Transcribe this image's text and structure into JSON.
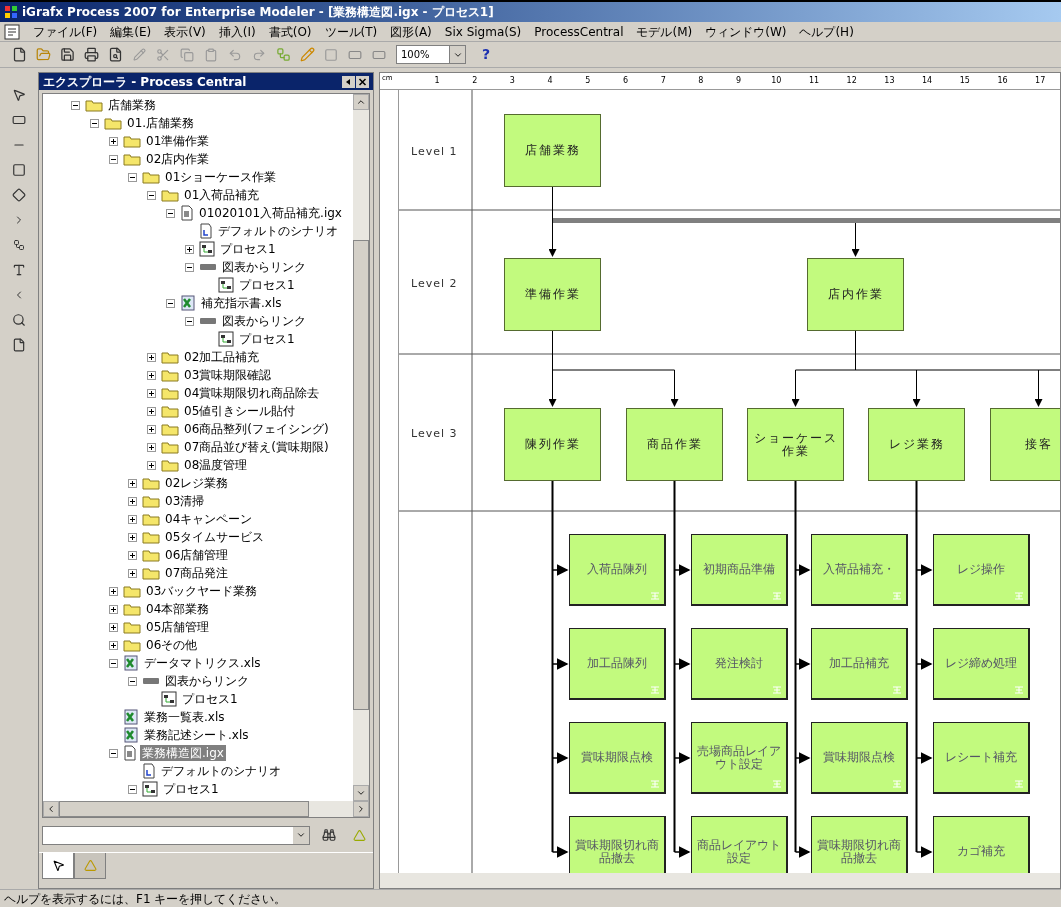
{
  "window": {
    "title": "iGrafx Process 2007 for Enterprise Modeler - [業務構造図.igx - プロセス1]"
  },
  "menu": [
    "ファイル(F)",
    "編集(E)",
    "表示(V)",
    "挿入(I)",
    "書式(O)",
    "ツール(T)",
    "図形(A)",
    "Six Sigma(S)",
    "ProcessCentral",
    "モデル(M)",
    "ウィンドウ(W)",
    "ヘルプ(H)"
  ],
  "toolbar": {
    "zoom": "100%",
    "help": "?"
  },
  "explorer": {
    "title": "エクスプローラ - Process Central",
    "tree": [
      {
        "label": "店舗業務",
        "kind": "folder",
        "expanded": true,
        "selected": false,
        "children": [
          {
            "label": "01.店舗業務",
            "kind": "folder",
            "expanded": true,
            "selected": false,
            "children": [
              {
                "label": "01準備作業",
                "kind": "folder",
                "expanded": false,
                "selected": false
              },
              {
                "label": "02店内作業",
                "kind": "folder",
                "expanded": true,
                "selected": false,
                "children": [
                  {
                    "label": "01ショーケース作業",
                    "kind": "folder",
                    "expanded": true,
                    "selected": false,
                    "children": [
                      {
                        "label": "01入荷品補充",
                        "kind": "folder",
                        "expanded": true,
                        "selected": false,
                        "children": [
                          {
                            "label": "01020101入荷品補充.igx",
                            "kind": "document",
                            "expanded": true,
                            "selected": false,
                            "children": [
                              {
                                "label": "デフォルトのシナリオ",
                                "kind": "scenario",
                                "selected": false
                              },
                              {
                                "label": "プロセス1",
                                "kind": "process",
                                "expanded": false,
                                "selected": false
                              },
                              {
                                "label": "図表からリンク",
                                "kind": "link",
                                "expanded": true,
                                "selected": false,
                                "children": [
                                  {
                                    "label": "プロセス1",
                                    "kind": "process",
                                    "selected": false
                                  }
                                ]
                              }
                            ]
                          },
                          {
                            "label": "補充指示書.xls",
                            "kind": "sheet",
                            "expanded": true,
                            "selected": false,
                            "children": [
                              {
                                "label": "図表からリンク",
                                "kind": "link",
                                "expanded": true,
                                "selected": false,
                                "children": [
                                  {
                                    "label": "プロセス1",
                                    "kind": "process",
                                    "selected": false
                                  }
                                ]
                              }
                            ]
                          }
                        ]
                      },
                      {
                        "label": "02加工品補充",
                        "kind": "folder",
                        "expanded": false,
                        "selected": false
                      },
                      {
                        "label": "03賞味期限確認",
                        "kind": "folder",
                        "expanded": false,
                        "selected": false
                      },
                      {
                        "label": "04賞味期限切れ商品除去",
                        "kind": "folder",
                        "expanded": false,
                        "selected": false
                      },
                      {
                        "label": "05値引きシール貼付",
                        "kind": "folder",
                        "expanded": false,
                        "selected": false
                      },
                      {
                        "label": "06商品整列(フェイシング)",
                        "kind": "folder",
                        "expanded": false,
                        "selected": false
                      },
                      {
                        "label": "07商品並び替え(賞味期限)",
                        "kind": "folder",
                        "expanded": false,
                        "selected": false
                      },
                      {
                        "label": "08温度管理",
                        "kind": "folder",
                        "expanded": false,
                        "selected": false
                      }
                    ]
                  },
                  {
                    "label": "02レジ業務",
                    "kind": "folder",
                    "expanded": false,
                    "selected": false
                  },
                  {
                    "label": "03清掃",
                    "kind": "folder",
                    "expanded": false,
                    "selected": false
                  },
                  {
                    "label": "04キャンペーン",
                    "kind": "folder",
                    "expanded": false,
                    "selected": false
                  },
                  {
                    "label": "05タイムサービス",
                    "kind": "folder",
                    "expanded": false,
                    "selected": false
                  },
                  {
                    "label": "06店舗管理",
                    "kind": "folder",
                    "expanded": false,
                    "selected": false
                  },
                  {
                    "label": "07商品発注",
                    "kind": "folder",
                    "expanded": false,
                    "selected": false
                  }
                ]
              },
              {
                "label": "03バックヤード業務",
                "kind": "folder",
                "expanded": false,
                "selected": false
              },
              {
                "label": "04本部業務",
                "kind": "folder",
                "expanded": false,
                "selected": false
              },
              {
                "label": "05店舗管理",
                "kind": "folder",
                "expanded": false,
                "selected": false
              },
              {
                "label": "06その他",
                "kind": "folder",
                "expanded": false,
                "selected": false
              },
              {
                "label": "データマトリクス.xls",
                "kind": "sheet",
                "expanded": true,
                "selected": false,
                "children": [
                  {
                    "label": "図表からリンク",
                    "kind": "link",
                    "expanded": true,
                    "selected": false,
                    "children": [
                      {
                        "label": "プロセス1",
                        "kind": "process",
                        "selected": false
                      }
                    ]
                  }
                ]
              },
              {
                "label": "業務一覧表.xls",
                "kind": "sheet",
                "selected": false
              },
              {
                "label": "業務記述シート.xls",
                "kind": "sheet",
                "selected": false
              },
              {
                "label": "業務構造図.igx",
                "kind": "document",
                "expanded": true,
                "selected": true,
                "children": [
                  {
                    "label": "デフォルトのシナリオ",
                    "kind": "scenario",
                    "selected": false
                  },
                  {
                    "label": "プロセス1",
                    "kind": "process",
                    "expanded": true,
                    "selected": false
                  }
                ]
              }
            ]
          }
        ]
      }
    ],
    "tabs": [
      {
        "selected": true
      },
      {
        "selected": false
      }
    ]
  },
  "diagram": {
    "ruler_unit": "cm",
    "ruler_marks": [
      "1",
      "2",
      "3",
      "4",
      "5",
      "6",
      "7",
      "8",
      "9",
      "10",
      "11",
      "12",
      "13",
      "14",
      "15",
      "16",
      "17"
    ],
    "levels": [
      {
        "label": "Level 1"
      },
      {
        "label": "Level 2"
      },
      {
        "label": "Level 3"
      }
    ],
    "root": {
      "text": "店舗業務",
      "children": [
        {
          "text": "準備作業",
          "children": [
            {
              "text": "陳列作業",
              "tasks": [
                "入荷品陳列",
                "加工品陳列",
                "賞味期限点検",
                "賞味期限切れ商品撤去"
              ]
            },
            {
              "text": "商品作業",
              "tasks": [
                "初期商品準備",
                "発注検討",
                "売場商品レイアウト設定",
                "商品レイアウト設定"
              ]
            }
          ]
        },
        {
          "text": "店内作業",
          "children": [
            {
              "text": "ショーケース作業",
              "tasks": [
                "入荷品補充・",
                "加工品補充",
                "賞味期限点検",
                "賞味期限切れ商品撤去"
              ]
            },
            {
              "text": "レジ業務",
              "tasks": [
                "レジ操作",
                "レジ締め処理",
                "レシート補充",
                "カゴ補充"
              ]
            },
            {
              "text": "接客"
            }
          ]
        }
      ]
    }
  },
  "status_bar": "ヘルプを表示するには、F1 キーを押してください。"
}
